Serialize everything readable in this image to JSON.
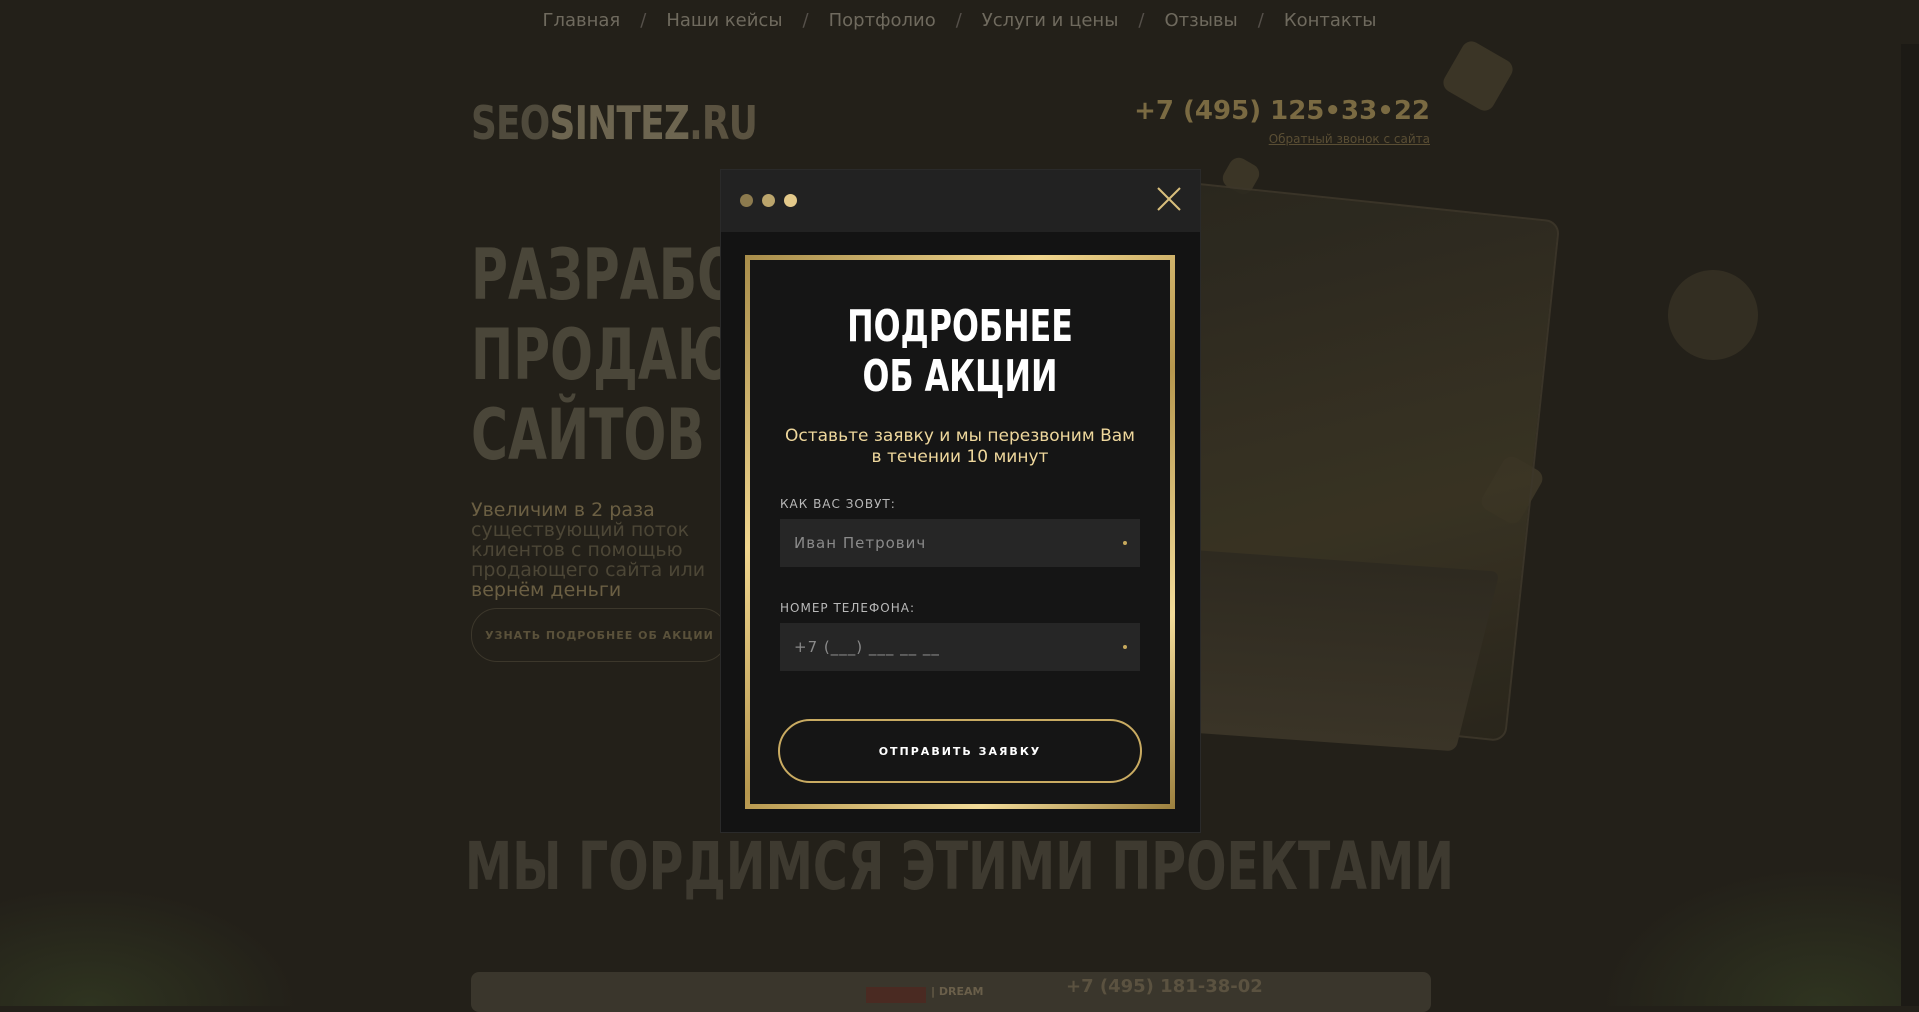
{
  "nav": {
    "items": [
      "Главная",
      "Наши кейсы",
      "Портфолио",
      "Услуги и цены",
      "Отзывы",
      "Контакты"
    ],
    "separator": "/"
  },
  "header": {
    "logo_part1": "SEO",
    "logo_part2": "SINTEZ",
    "logo_part3": ".RU",
    "phone": "+7 (495) 125•33•22",
    "callback_link": "Обратный звонок с сайта"
  },
  "hero": {
    "title_lines": [
      "РАЗРАБОТКА",
      "ПРОДАЮЩИХ",
      "САЙТОВ"
    ],
    "text_part1": "Увеличим в 2 раза",
    "text_part2": " существующий поток клиентов с помощью продающего сайта или ",
    "text_part3": "вернём деньги",
    "button_label": "УЗНАТЬ ПОДРОБНЕЕ ОБ АКЦИИ"
  },
  "projects": {
    "title": "МЫ ГОРДИМСЯ ЭТИМИ ПРОЕКТАМИ",
    "card_phone": "+7 (495) 181-38-02",
    "card_brand": "| DREAM"
  },
  "modal": {
    "title_line1": "ПОДРОБНЕЕ",
    "title_line2": "ОБ АКЦИИ",
    "subtitle_line1": "Оставьте заявку и мы перезвоним Вам",
    "subtitle_line2": "в течении 10 минут",
    "name_label": "КАК ВАС ЗОВУТ:",
    "name_placeholder": "Иван Петрович",
    "phone_label": "НОМЕР ТЕЛЕФОНА:",
    "phone_placeholder": "+7 (___) ___ __ __",
    "submit_label": "ОТПРАВИТЬ ЗАЯВКУ"
  },
  "colors": {
    "gold": "#c9ab62",
    "gold_light": "#eed79c",
    "modal_bg": "#131313",
    "header_bg": "#222222",
    "page_bg": "#232019"
  }
}
